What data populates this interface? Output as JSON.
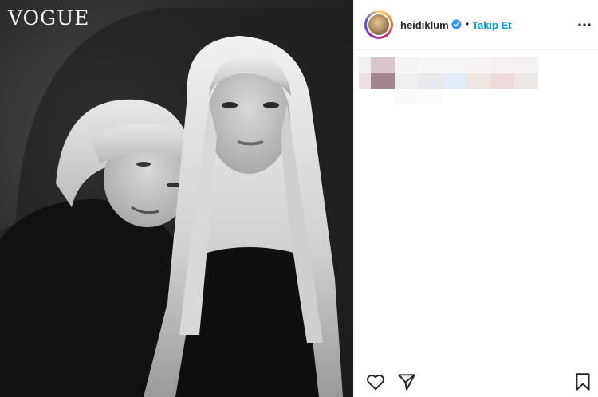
{
  "photo": {
    "masthead": "VOGUE"
  },
  "post": {
    "username": "heidiklum",
    "separator": "•",
    "follow_label": "Takip Et",
    "more_label": "•••"
  },
  "icons": {
    "verified": "verified-badge-icon",
    "like": "heart-icon",
    "share": "paper-plane-icon",
    "save": "bookmark-icon"
  },
  "colors": {
    "follow": "#0095f6",
    "verified": "#3897f0",
    "text": "#262626"
  }
}
